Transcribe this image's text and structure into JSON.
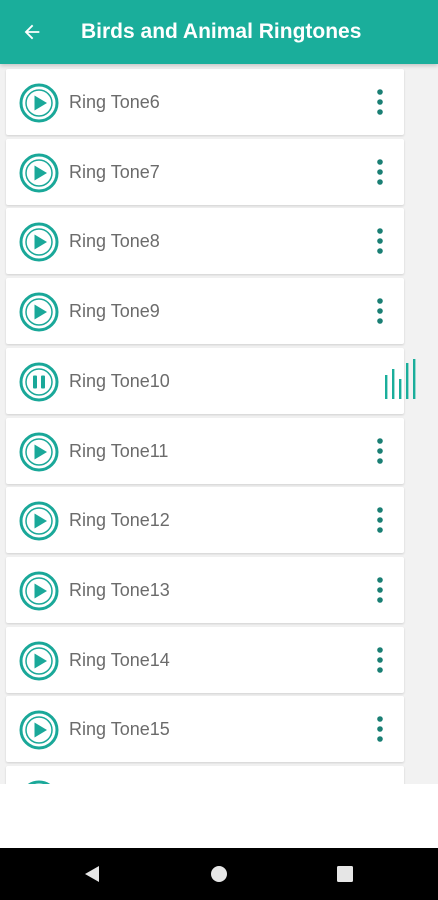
{
  "colors": {
    "accent": "#1aae9b",
    "play_icon": "#1aa899",
    "more": "#1a7f74"
  },
  "appbar": {
    "title": "Birds and Animal Ringtones",
    "back_icon": "arrow-left-icon"
  },
  "ringtones": [
    {
      "label": "Ring Tone6",
      "state": "stopped"
    },
    {
      "label": "Ring Tone7",
      "state": "stopped"
    },
    {
      "label": "Ring Tone8",
      "state": "stopped"
    },
    {
      "label": "Ring Tone9",
      "state": "stopped"
    },
    {
      "label": "Ring Tone10",
      "state": "playing"
    },
    {
      "label": "Ring Tone11",
      "state": "stopped"
    },
    {
      "label": "Ring Tone12",
      "state": "stopped"
    },
    {
      "label": "Ring Tone13",
      "state": "stopped"
    },
    {
      "label": "Ring Tone14",
      "state": "stopped"
    },
    {
      "label": "Ring Tone15",
      "state": "stopped"
    },
    {
      "label": "",
      "state": "stopped"
    }
  ],
  "navbar": {
    "back_icon": "triangle-back-icon",
    "home_icon": "circle-home-icon",
    "recents_icon": "square-recents-icon"
  }
}
